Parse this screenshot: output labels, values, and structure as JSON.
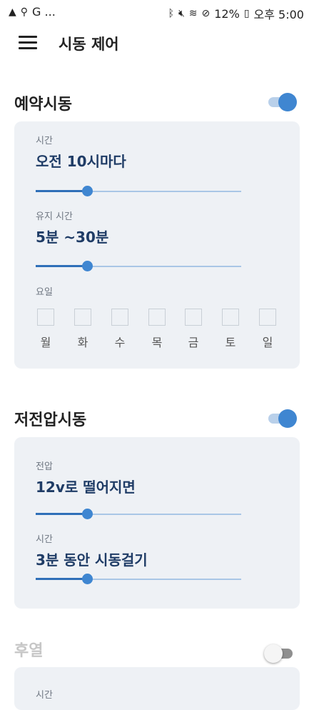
{
  "status_bar": {
    "left_icons": [
      "warning-icon",
      "keyhole-icon"
    ],
    "left_text": "G ...",
    "right_icons": [
      "bluetooth-icon",
      "mute-icon",
      "wifi-icon",
      "do-not-disturb-icon"
    ],
    "battery_percent": "12%",
    "time": "오후 5:00"
  },
  "app_bar": {
    "title": "시동 제어",
    "menu_icon": "hamburger-menu-icon"
  },
  "sections": {
    "scheduled": {
      "title": "예약시동",
      "enabled": true,
      "time_label": "시간",
      "time_value": "오전 10시마다",
      "time_slider": 0.25,
      "duration_label": "유지 시간",
      "duration_value": "5분 ~30분",
      "duration_slider": 0.25,
      "days_label": "요일",
      "days": [
        {
          "label": "월",
          "checked": false
        },
        {
          "label": "화",
          "checked": false
        },
        {
          "label": "수",
          "checked": false
        },
        {
          "label": "목",
          "checked": false
        },
        {
          "label": "금",
          "checked": false
        },
        {
          "label": "토",
          "checked": false
        },
        {
          "label": "일",
          "checked": false
        }
      ]
    },
    "low_voltage": {
      "title": "저전압시동",
      "enabled": true,
      "voltage_label": "전압",
      "voltage_value": "12v로 떨어지면",
      "voltage_slider": 0.25,
      "time_label": "시간",
      "time_value": "3분 동안 시동걸기",
      "time_slider": 0.25
    },
    "preheat": {
      "title": "후열",
      "enabled": false,
      "time_label": "시간"
    }
  },
  "colors": {
    "accent": "#3f86d1",
    "value_text": "#1f3c66",
    "card_bg": "#eef1f5"
  }
}
